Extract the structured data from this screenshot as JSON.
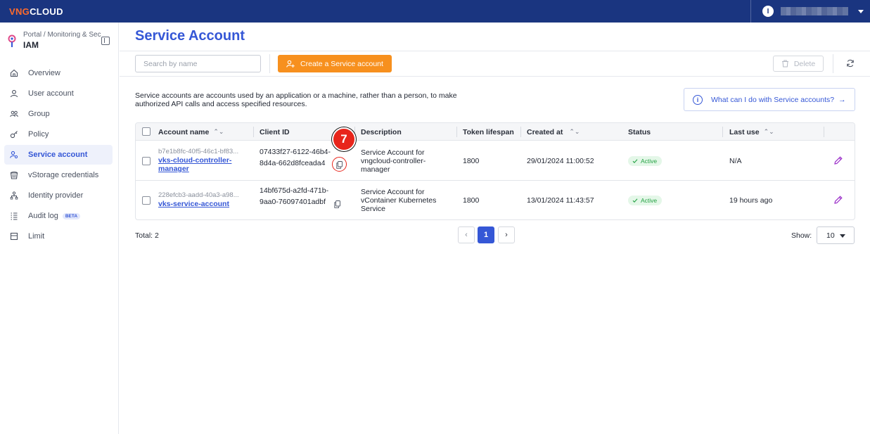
{
  "topbar": {
    "logo_prefix": "VNG",
    "logo_suffix": "CLOUD",
    "avatar_initial": "I"
  },
  "sidebar": {
    "breadcrumb": "Portal  /  Monitoring & Sec",
    "title": "IAM",
    "items": [
      {
        "label": "Overview",
        "icon": "home-icon"
      },
      {
        "label": "User account",
        "icon": "user-icon"
      },
      {
        "label": "Group",
        "icon": "group-icon"
      },
      {
        "label": "Policy",
        "icon": "policy-icon"
      },
      {
        "label": "Service account",
        "icon": "service-account-icon",
        "active": true
      },
      {
        "label": "vStorage credentials",
        "icon": "storage-icon"
      },
      {
        "label": "Identity provider",
        "icon": "identity-provider-icon"
      },
      {
        "label": "Audit log",
        "icon": "audit-log-icon",
        "badge": "BETA"
      },
      {
        "label": "Limit",
        "icon": "limit-icon"
      }
    ]
  },
  "main": {
    "title": "Service Account",
    "search_placeholder": "Search by name",
    "create_label": "Create a Service account",
    "delete_label": "Delete",
    "intro_line1": "Service accounts are accounts used by an application or a machine, rather than a person, to make",
    "intro_line2": "authorized API calls and access specified resources.",
    "help_label": "What can I do with Service accounts?",
    "help_arrow": "→"
  },
  "table": {
    "columns": {
      "account_name": "Account name",
      "client_id": "Client ID",
      "description": "Description",
      "token_lifespan": "Token lifespan",
      "created_at": "Created at",
      "status": "Status",
      "last_use": "Last use"
    },
    "rows": [
      {
        "account_id": "b7e1b8fc-40f5-46c1-bf83...",
        "name_l1": "vks-cloud-controller-",
        "name_l2": "manager",
        "client_l1": "07433f27-6122-46b4-",
        "client_l2": "8d4a-662d8fceada4",
        "desc_l1": "Service Account for",
        "desc_l2": "vngcloud-controller-",
        "desc_l3": "manager",
        "token": "1800",
        "created": "29/01/2024 11:00:52",
        "status": "Active",
        "last_use": "N/A"
      },
      {
        "account_id": "228efcb3-aadd-40a3-a98...",
        "name_l1": "vks-service-account",
        "name_l2": "",
        "client_l1": "14bf675d-a2fd-471b-",
        "client_l2": "9aa0-76097401adbf",
        "desc_l1": "Service Account for",
        "desc_l2": "vContainer Kubernetes",
        "desc_l3": "Service",
        "token": "1800",
        "created": "13/01/2024 11:43:57",
        "status": "Active",
        "last_use": "19 hours ago"
      }
    ]
  },
  "footer": {
    "total": "Total: 2",
    "prev": "‹",
    "page": "1",
    "next": "›",
    "show_label": "Show:",
    "page_size": "10"
  },
  "annotation": {
    "step": "7"
  },
  "colors": {
    "brand_blue": "#1a3580",
    "accent_blue": "#3557d6",
    "create_orange": "#f7901e",
    "status_green": "#25a244",
    "marker_red": "#e8251b"
  }
}
